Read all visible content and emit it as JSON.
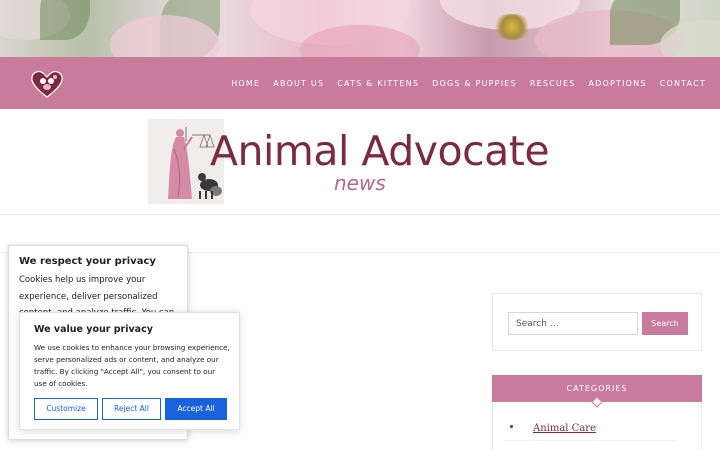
{
  "colors": {
    "brand_pink": "#c97b9b",
    "title_maroon": "#7a2a43",
    "tagline_pink": "#b06a88",
    "cookie_blue": "#1863dc"
  },
  "hero": {
    "icon": "pink-flower-banner-image"
  },
  "header": {
    "logo_icon": "heart-paw-logo-icon",
    "nav": [
      {
        "label": "HOME"
      },
      {
        "label": "ABOUT US"
      },
      {
        "label": "CATS & KITTENS"
      },
      {
        "label": "DOGS & PUPPIES"
      },
      {
        "label": "RESCUES"
      },
      {
        "label": "ADOPTIONS"
      },
      {
        "label": "CONTACT"
      }
    ]
  },
  "site": {
    "title": "Animal Advocate",
    "tagline": "news",
    "emblem_icon": "lady-justice-with-pets-icon"
  },
  "sidebar": {
    "search": {
      "placeholder": "Search …",
      "button_label": "Search"
    },
    "categories": {
      "heading": "CATEGORIES",
      "items": [
        {
          "label": "Animal Care"
        }
      ]
    }
  },
  "cookie_back": {
    "title": "We respect your privacy",
    "body": "Cookies help us improve your experience, deliver personalized content, and analyze traffic. You can"
  },
  "cookie_front": {
    "title": "We value your privacy",
    "body": "We use cookies to enhance your browsing experience, serve personalized ads or content, and analyze our traffic. By clicking \"Accept All\", you consent to our use of cookies.",
    "buttons": {
      "customize": "Customize",
      "reject": "Reject All",
      "accept": "Accept All"
    }
  }
}
